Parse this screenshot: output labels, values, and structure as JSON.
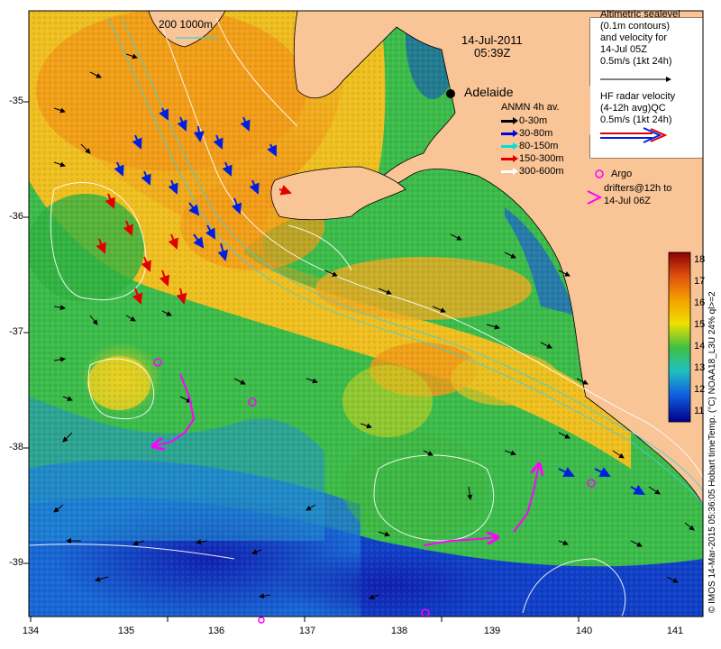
{
  "header": {
    "date": "14-Jul-2011",
    "time": "05:39Z",
    "scale_label": "200  1000m"
  },
  "places": [
    {
      "name": "Adelaide"
    }
  ],
  "altimetry_note": {
    "lines": [
      "Altimetric sealevel",
      "(0.1m contours)",
      "and velocity for",
      "14-Jul 05Z",
      "0.5m/s (1kt 24h)"
    ]
  },
  "hf_radar_note": {
    "lines": [
      "HF radar velocity",
      "(4-12h avg)QC",
      "0.5m/s (1kt 24h)"
    ]
  },
  "anmn_legend": {
    "title": "ANMN 4h av.",
    "items": [
      {
        "label": "0-30m",
        "color": "#000000"
      },
      {
        "label": "30-80m",
        "color": "#0000e0"
      },
      {
        "label": "80-150m",
        "color": "#00e0e0"
      },
      {
        "label": "150-300m",
        "color": "#e00000"
      },
      {
        "label": "300-600m",
        "color": "#ffffff"
      }
    ]
  },
  "argo_note": {
    "lines": [
      "Argo",
      "drifters@12h to",
      "14-Jul 06Z"
    ]
  },
  "colorbar": {
    "label": "Temp. (°C) NOAA18_L3U 24% ql>=2",
    "ticks": [
      "18",
      "17",
      "16",
      "15",
      "14",
      "13",
      "12",
      "11"
    ]
  },
  "credit": "© IMOS 14-Mar-2015 05:36:05 Hobart time",
  "axes": {
    "x_ticks": [
      "134",
      "135",
      "136",
      "137",
      "138",
      "139",
      "140",
      "141"
    ],
    "y_ticks": [
      "-35",
      "-36",
      "-37",
      "-38",
      "-39"
    ]
  },
  "colors": {
    "land": "#f9c496",
    "argo": "#ff00ff"
  }
}
